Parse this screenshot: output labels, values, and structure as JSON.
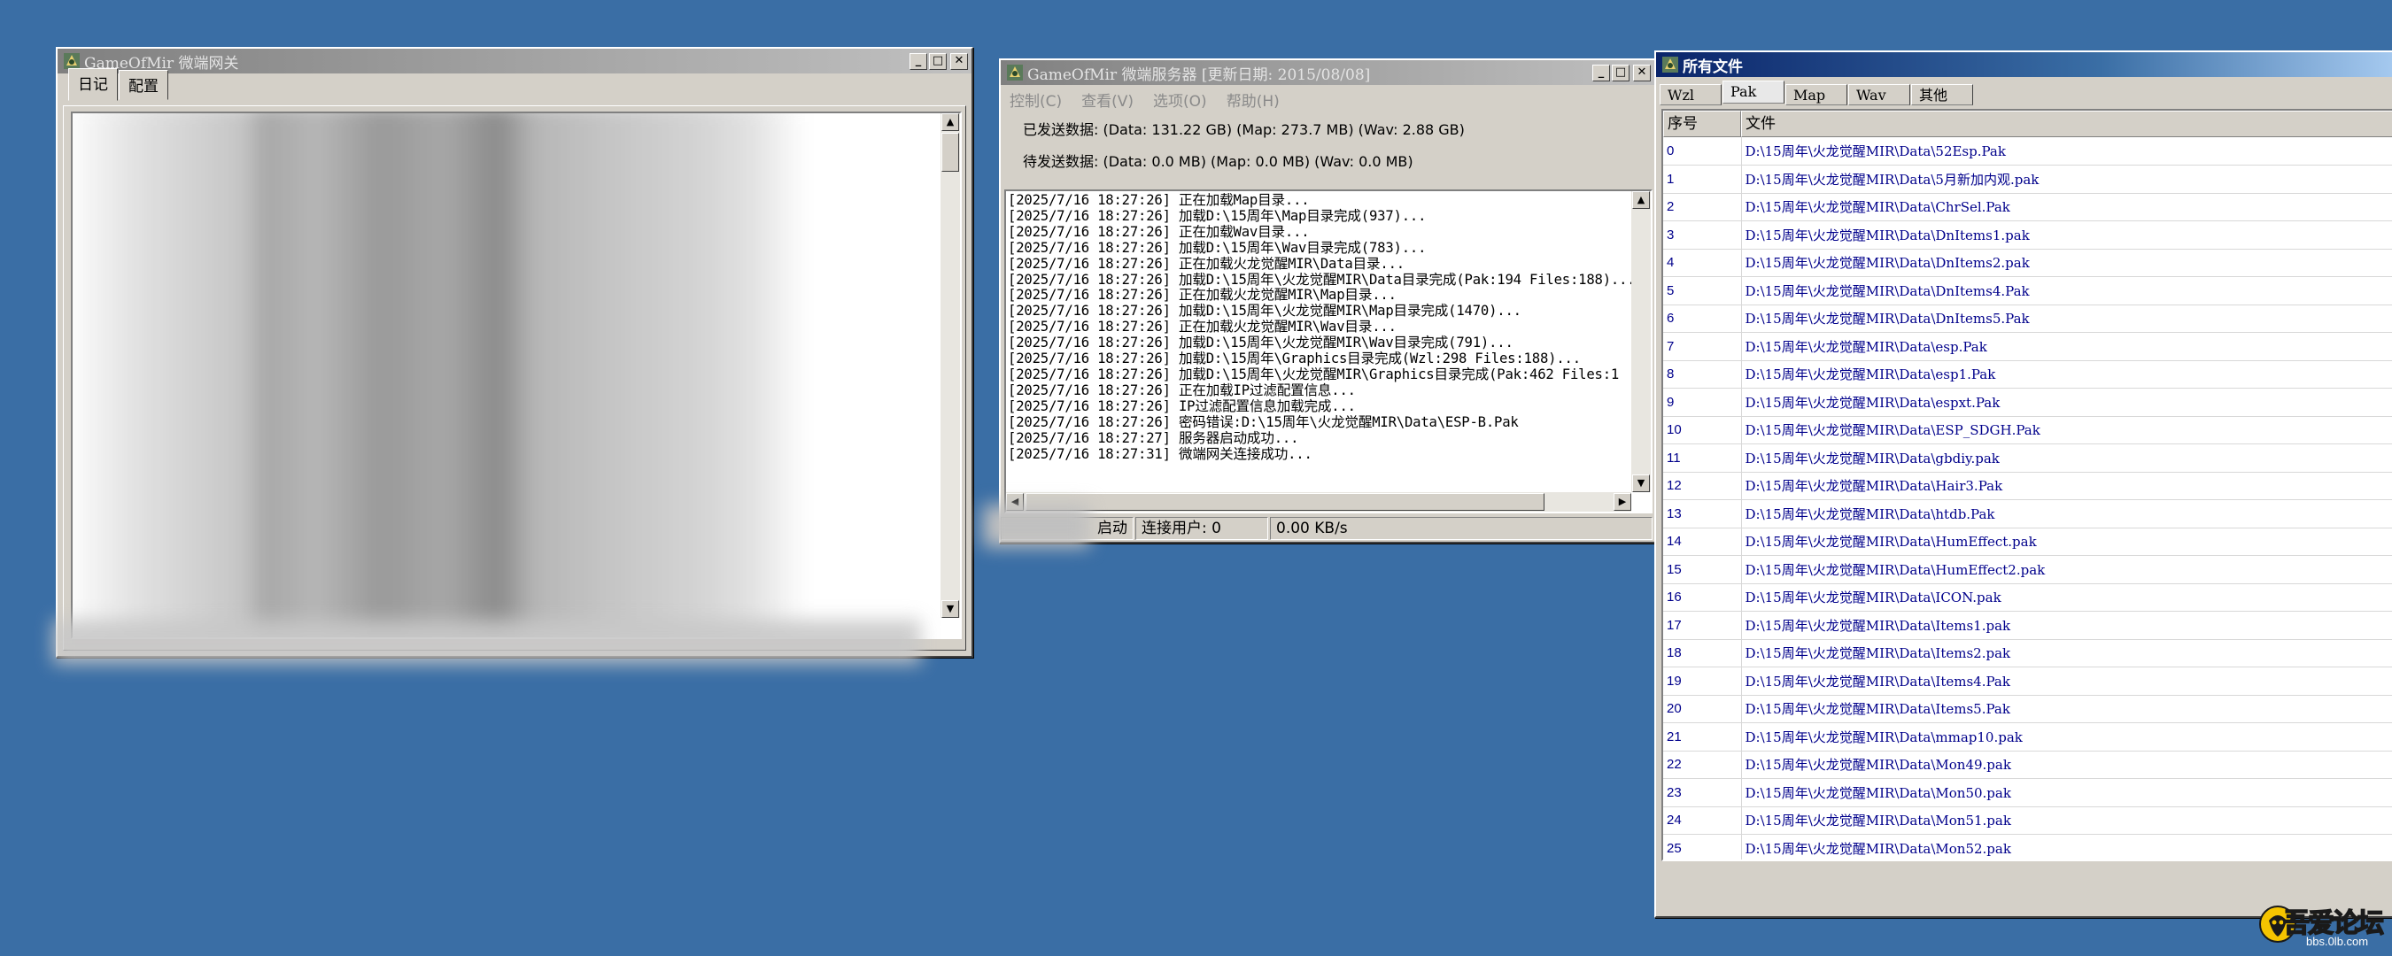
{
  "gateway_window": {
    "title": "GameOfMir 微端网关",
    "tabs": [
      "日记",
      "配置"
    ],
    "buttons": {
      "minimize": "_",
      "maximize": "□",
      "close": "✕"
    }
  },
  "server_window": {
    "title": "GameOfMir 微端服务器 [更新日期: 2015/08/08]",
    "menu": [
      "控制(C)",
      "查看(V)",
      "选项(O)",
      "帮助(H)"
    ],
    "sent_data": "已发送数据: (Data: 131.22 GB) (Map: 273.7 MB) (Wav: 2.88 GB)",
    "pending_data": "待发送数据: (Data: 0.0 MB) (Map: 0.0 MB) (Wav: 0.0 MB)",
    "log_lines": [
      "[2025/7/16 18:27:26] 正在加载Map目录...",
      "[2025/7/16 18:27:26] 加载D:\\15周年\\Map目录完成(937)...",
      "[2025/7/16 18:27:26] 正在加载Wav目录...",
      "[2025/7/16 18:27:26] 加载D:\\15周年\\Wav目录完成(783)...",
      "[2025/7/16 18:27:26] 正在加载火龙觉醒MIR\\Data目录...",
      "[2025/7/16 18:27:26] 加载D:\\15周年\\火龙觉醒MIR\\Data目录完成(Pak:194 Files:188)...",
      "[2025/7/16 18:27:26] 正在加载火龙觉醒MIR\\Map目录...",
      "[2025/7/16 18:27:26] 加载D:\\15周年\\火龙觉醒MIR\\Map目录完成(1470)...",
      "[2025/7/16 18:27:26] 正在加载火龙觉醒MIR\\Wav目录...",
      "[2025/7/16 18:27:26] 加载D:\\15周年\\火龙觉醒MIR\\Wav目录完成(791)...",
      "[2025/7/16 18:27:26] 加载D:\\15周年\\Graphics目录完成(Wzl:298 Files:188)...",
      "[2025/7/16 18:27:26] 加载D:\\15周年\\火龙觉醒MIR\\Graphics目录完成(Pak:462 Files:1",
      "[2025/7/16 18:27:26] 正在加载IP过滤配置信息...",
      "[2025/7/16 18:27:26] IP过滤配置信息加载完成...",
      "[2025/7/16 18:27:26] 密码错误:D:\\15周年\\火龙觉醒MIR\\Data\\ESP-B.Pak",
      "[2025/7/16 18:27:27] 服务器启动成功...",
      "[2025/7/16 18:27:31] 微端网关连接成功..."
    ],
    "status": {
      "state": "启动",
      "users": "连接用户: 0",
      "speed": "0.00 KB/s"
    },
    "buttons": {
      "minimize": "_",
      "maximize": "□",
      "close": "✕"
    }
  },
  "files_window": {
    "title": "所有文件",
    "tabs": [
      "Wzl",
      "Pak",
      "Map",
      "Wav",
      "其他"
    ],
    "selected_tab": "Pak",
    "columns": [
      "序号",
      "文件"
    ],
    "rows": [
      [
        "0",
        "D:\\15周年\\火龙觉醒MIR\\Data\\52Esp.Pak"
      ],
      [
        "1",
        "D:\\15周年\\火龙觉醒MIR\\Data\\5月新加内观.pak"
      ],
      [
        "2",
        "D:\\15周年\\火龙觉醒MIR\\Data\\ChrSel.Pak"
      ],
      [
        "3",
        "D:\\15周年\\火龙觉醒MIR\\Data\\DnItems1.pak"
      ],
      [
        "4",
        "D:\\15周年\\火龙觉醒MIR\\Data\\DnItems2.pak"
      ],
      [
        "5",
        "D:\\15周年\\火龙觉醒MIR\\Data\\DnItems4.Pak"
      ],
      [
        "6",
        "D:\\15周年\\火龙觉醒MIR\\Data\\DnItems5.Pak"
      ],
      [
        "7",
        "D:\\15周年\\火龙觉醒MIR\\Data\\esp.Pak"
      ],
      [
        "8",
        "D:\\15周年\\火龙觉醒MIR\\Data\\esp1.Pak"
      ],
      [
        "9",
        "D:\\15周年\\火龙觉醒MIR\\Data\\espxt.Pak"
      ],
      [
        "10",
        "D:\\15周年\\火龙觉醒MIR\\Data\\ESP_SDGH.Pak"
      ],
      [
        "11",
        "D:\\15周年\\火龙觉醒MIR\\Data\\gbdiy.pak"
      ],
      [
        "12",
        "D:\\15周年\\火龙觉醒MIR\\Data\\Hair3.Pak"
      ],
      [
        "13",
        "D:\\15周年\\火龙觉醒MIR\\Data\\htdb.Pak"
      ],
      [
        "14",
        "D:\\15周年\\火龙觉醒MIR\\Data\\HumEffect.pak"
      ],
      [
        "15",
        "D:\\15周年\\火龙觉醒MIR\\Data\\HumEffect2.pak"
      ],
      [
        "16",
        "D:\\15周年\\火龙觉醒MIR\\Data\\ICON.pak"
      ],
      [
        "17",
        "D:\\15周年\\火龙觉醒MIR\\Data\\Items1.pak"
      ],
      [
        "18",
        "D:\\15周年\\火龙觉醒MIR\\Data\\Items2.pak"
      ],
      [
        "19",
        "D:\\15周年\\火龙觉醒MIR\\Data\\Items4.Pak"
      ],
      [
        "20",
        "D:\\15周年\\火龙觉醒MIR\\Data\\Items5.Pak"
      ],
      [
        "21",
        "D:\\15周年\\火龙觉醒MIR\\Data\\mmap10.pak"
      ],
      [
        "22",
        "D:\\15周年\\火龙觉醒MIR\\Data\\Mon49.pak"
      ],
      [
        "23",
        "D:\\15周年\\火龙觉醒MIR\\Data\\Mon50.pak"
      ],
      [
        "24",
        "D:\\15周年\\火龙觉醒MIR\\Data\\Mon51.pak"
      ],
      [
        "25",
        "D:\\15周年\\火龙觉醒MIR\\Data\\Mon52.pak"
      ]
    ]
  },
  "watermark": {
    "text": "吾爱论坛",
    "url": "bbs.0lb.com"
  },
  "colors": {
    "desktop": "#3a6ea5",
    "file_text": "#00008b",
    "title_active": "#0a246a"
  }
}
